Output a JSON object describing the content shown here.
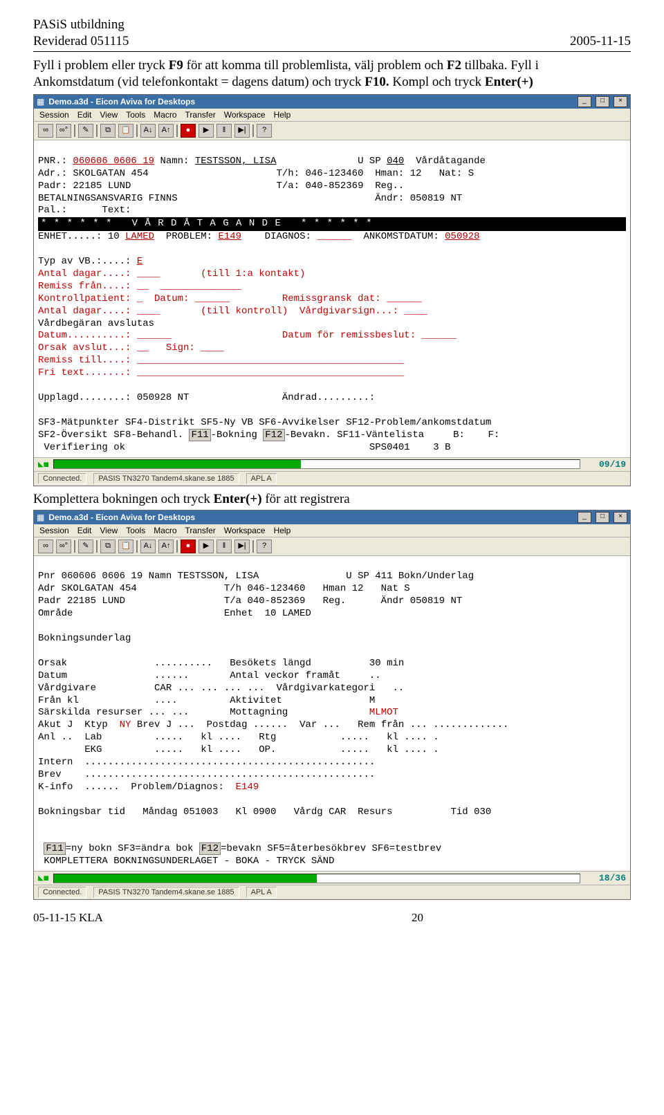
{
  "doc": {
    "header_left1": "PASiS utbildning",
    "header_left2": "Reviderad 051115",
    "header_right": "2005-11-15",
    "para_line1_a": "Fyll i problem eller tryck ",
    "para_line1_f9": "F9",
    "para_line1_b": " för att komma till problemlista, välj problem och ",
    "para_line1_f2": "F2",
    "para_line1_c": " tillbaka. Fyll i",
    "para_line2_a": "Ankomstdatum (vid telefonkontakt = dagens datum) och tryck ",
    "para_line2_f10": "F10.",
    "para_line2_b": " Kompl och tryck ",
    "para_line2_enter": "Enter(+)",
    "caption2_a": "Komplettera bokningen och tryck ",
    "caption2_enter": "Enter(+)",
    "caption2_b": " för att registrera",
    "footer_left": "05-11-15 KLA",
    "footer_page": "20"
  },
  "win": {
    "title": "Demo.a3d - Eicon Aviva for Desktops",
    "menu": [
      "Session",
      "Edit",
      "View",
      "Tools",
      "Macro",
      "Transfer",
      "Workspace",
      "Help"
    ],
    "min": "_",
    "max": "□",
    "close": "×",
    "status_conn": "Connected.",
    "status_host": "PASIS   TN3270  Tandem4.skane.se   1885",
    "status_api": "APL A"
  },
  "term1": {
    "pnr_lbl": "PNR.: ",
    "pnr": "060606 0606 19",
    "namn_lbl": " Namn: ",
    "namn": "TESTSSON, LISA",
    "u": "U SP ",
    "usp": "040",
    "usp_lbl": "  Vårdåtagande",
    "adr": "Adr.: SKOLGATAN 454                      T/h: 046-123460  Hman: 12   Nat: S",
    "padr": "Padr: 22185 LUND                         T/a: 040-852369  Reg..",
    "bet": "BETALNINGSANSVARIG FINNS                                  Ändr: 050819 NT",
    "pal": "Pal.:      Text:",
    "banner": "* * * * * *   V Å R D Å T A G A N D E   * * * * * *",
    "enhet_line_a": "ENHET.....: 10 ",
    "enhet_unit": "LAMED",
    "enhet_line_b": "  PROBLEM: ",
    "problem": "E149",
    "enhet_line_c": "    DIAGNOS: ",
    "diag_blank": "______",
    "enhet_line_d": "  ANKOMSTDATUM: ",
    "ankomst": "050928",
    "typ": "Typ av VB.:....: ",
    "typ_e": "E",
    "dagar1": "Antal dagar....: ____       (till 1:a kontakt)",
    "remiss": "Remiss från....: __  ______________",
    "kontroll": "Kontrollpatient: _  Datum: ______         Remissgransk dat: ______",
    "dagar2": "Antal dagar....: ____       (till kontroll)  Vårdgivarsign...: ____",
    "vardbeg": "Vårdbegäran avslutas",
    "datum": "Datum..........: ______                   Datum för remissbeslut: ______",
    "orsak": "Orsak avslut...: __   Sign: ____",
    "remisst": "Remiss till....: ______________________________________________",
    "fritext": "Fri text.......: ______________________________________________",
    "upplagd": "Upplagd........: 050928 NT                Ändrad.........:",
    "sf3": "SF3-Mätpunkter SF4-Distrikt SF5-Ny VB SF6-Avvikelser SF12-Problem/ankomstdatum",
    "sf2a": "SF2-Översikt SF8-Behandl. ",
    "f11": "F11",
    "sf2b": "-Bokning ",
    "f12": "F12",
    "sf2c": "-Bevakn. SF11-Väntelista     B:    F:",
    "ver": " Verifiering ok                                          SPS0401    3 B",
    "prog": "09/19"
  },
  "term2": {
    "pnr": "Pnr 060606 0606 19 Namn TESTSSON, LISA               U SP 411 Bokn/Underlag",
    "adr": "Adr SKOLGATAN 454               T/h 046-123460   Hman 12   Nat S",
    "padr": "Padr 22185 LUND                 T/a 040-852369   Reg.      Ändr 050819 NT",
    "omr": "Område                          Enhet  10 LAMED",
    "bok": "Bokningsunderlag",
    "orsak": "Orsak               ..........   Besökets längd          30 min",
    "datum": "Datum               ......       Antal veckor framåt     ..",
    "vardg": "Vårdgivare          CAR ... ... ... ...  Vårdgivarkategori   ..",
    "fran": "Från kl             ....         Aktivitet               M",
    "sres": "Särskilda resurser ... ...       Mottagning              ",
    "mottag": "MLMOT",
    "akut": "Akut J  Ktyp  ",
    "ny": "NY",
    "akut_b": " Brev J ...  Postdag ......  Var ...   Rem från ... .............",
    "anl": "Anl ..  Lab         .....   kl ....   Rtg           .....   kl .... .",
    "ekg": "        EKG         .....   kl ....   OP.           .....   kl .... .",
    "intern": "Intern  ..................................................",
    "brev": "Brev    ..................................................",
    "kinfo_a": "K-info  ......  Problem/Diagnos:  ",
    "kinfo_val": "E149",
    "boktid": "Bokningsbar tid   Måndag 051003   Kl 0900   Vårdg CAR  Resurs          Tid 030",
    "f11": "F11",
    "ny_txt": "=ny bokn SF3=ändra bok ",
    "f12": "F12",
    "rest": "=bevakn SF5=återbesökbrev SF6=testbrev",
    "komp": "KOMPLETTERA BOKNINGSUNDERLAGET - BOKA - TRYCK SÄND",
    "prog": "18/36"
  }
}
